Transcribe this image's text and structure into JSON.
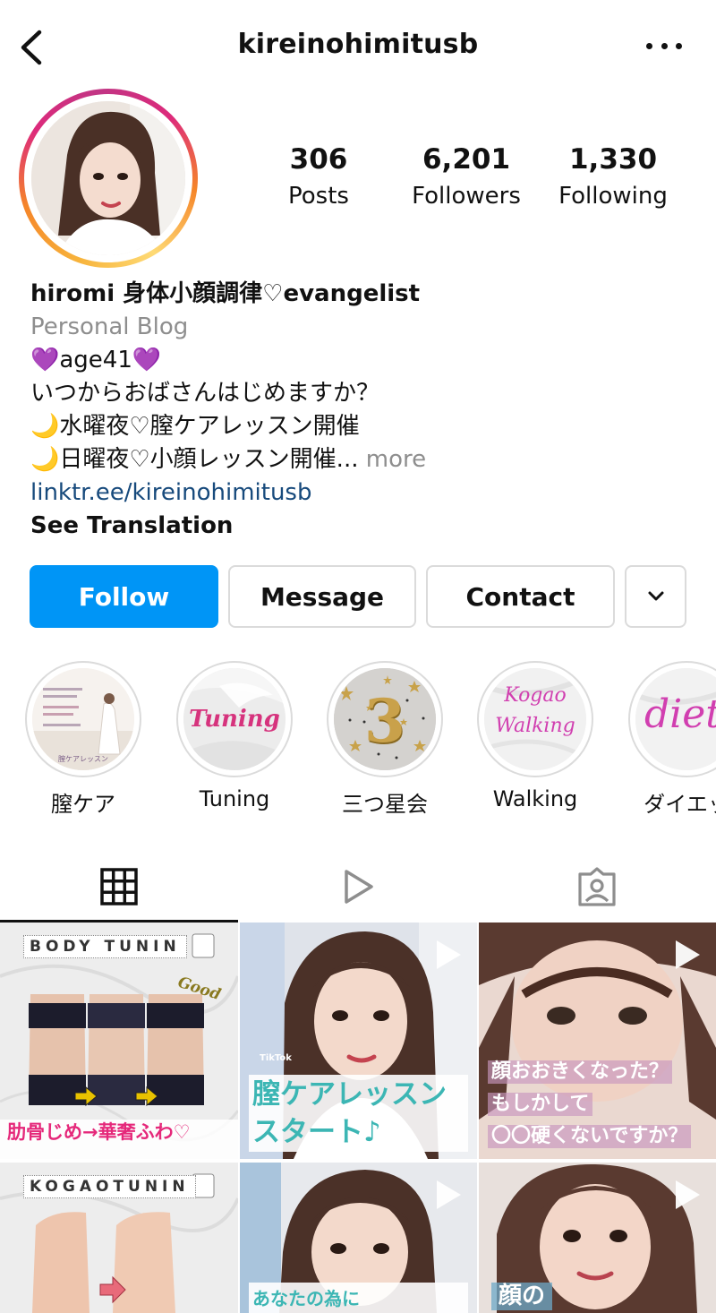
{
  "header": {
    "username": "kireinohimitusb"
  },
  "stats": {
    "posts": {
      "value": "306",
      "label": "Posts"
    },
    "followers": {
      "value": "6,201",
      "label": "Followers"
    },
    "following": {
      "value": "1,330",
      "label": "Following"
    }
  },
  "bio": {
    "name": "hiromi 身体小顔調律♡evangelist",
    "category": "Personal Blog",
    "line1": "💜age41💜",
    "line2": "いつからおばさんはじめますか？",
    "line3": "🌙水曜夜♡膣ケアレッスン開催",
    "line4": "🌙日曜夜♡小顔レッスン開催...",
    "more": "more",
    "link": "linktr.ee/kireinohimitusb",
    "translate": "See Translation"
  },
  "actions": {
    "follow": "Follow",
    "message": "Message",
    "contact": "Contact"
  },
  "highlights": [
    {
      "label": "膣ケア",
      "cover_text": "膣ケアレッスン"
    },
    {
      "label": "Tuning",
      "cover_text": "Tuning"
    },
    {
      "label": "三つ星会",
      "cover_text": "3"
    },
    {
      "label": "Walking",
      "cover_text_1": "Kogao",
      "cover_text_2": "Walking"
    },
    {
      "label": "ダイエッ",
      "cover_text": "diet"
    }
  ],
  "posts": [
    {
      "header": "BODY TUNIN",
      "accent": "Good",
      "caption": "肋骨じめ→華奢ふわ♡"
    },
    {
      "caption_1": "膣ケアレッスン",
      "caption_2": "スタート♪",
      "watermark": "TikTok"
    },
    {
      "caption_1": "顔おおきくなった？",
      "caption_2": "もしかして",
      "caption_3": "〇〇硬くないですか？"
    },
    {
      "header": "KOGAOTUNIN"
    },
    {
      "caption_1": "あなたの為に"
    },
    {
      "caption_1": "顔の"
    }
  ],
  "colors": {
    "follow_blue": "#0095f6",
    "link_blue": "#174a7c",
    "muted_gray": "#8e8e8e",
    "caption_pink": "#e5287a",
    "caption_teal": "#3cb6b4"
  }
}
